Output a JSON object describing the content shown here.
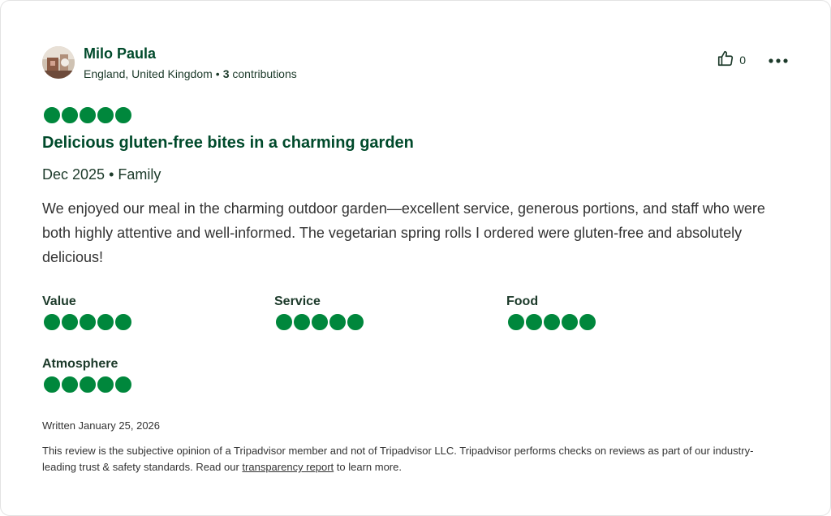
{
  "review": {
    "user": {
      "name": "Milo Paula",
      "location": "England, United Kingdom",
      "bullet": "•",
      "contributions_count": "3",
      "contributions_label": "contributions"
    },
    "actions": {
      "like_icon": "thumbs-up-icon",
      "like_count": "0",
      "more_icon": "more-options-icon"
    },
    "rating": 5,
    "title": "Delicious gluten-free bites in a charming garden",
    "trip": {
      "date": "Dec 2025",
      "bullet": "•",
      "type": "Family"
    },
    "body": "We enjoyed our meal in the charming outdoor garden—excellent service, generous portions, and staff who were both highly attentive and well-informed. The vegetarian spring rolls I ordered were gluten-free and absolutely delicious!",
    "subratings": {
      "value": {
        "label": "Value",
        "rating": 5
      },
      "service": {
        "label": "Service",
        "rating": 5
      },
      "food": {
        "label": "Food",
        "rating": 5
      },
      "atmosphere": {
        "label": "Atmosphere",
        "rating": 5
      }
    },
    "written": "Written January 25, 2026",
    "disclaimer": {
      "before": "This review is the subjective opinion of a Tripadvisor member and not of Tripadvisor LLC. Tripadvisor performs checks on reviews as part of our industry-leading trust & safety standards. Read our ",
      "link": "transparency report",
      "after": " to learn more."
    }
  },
  "colors": {
    "bubble_filled": "#00873c",
    "title_green": "#004a2b"
  }
}
